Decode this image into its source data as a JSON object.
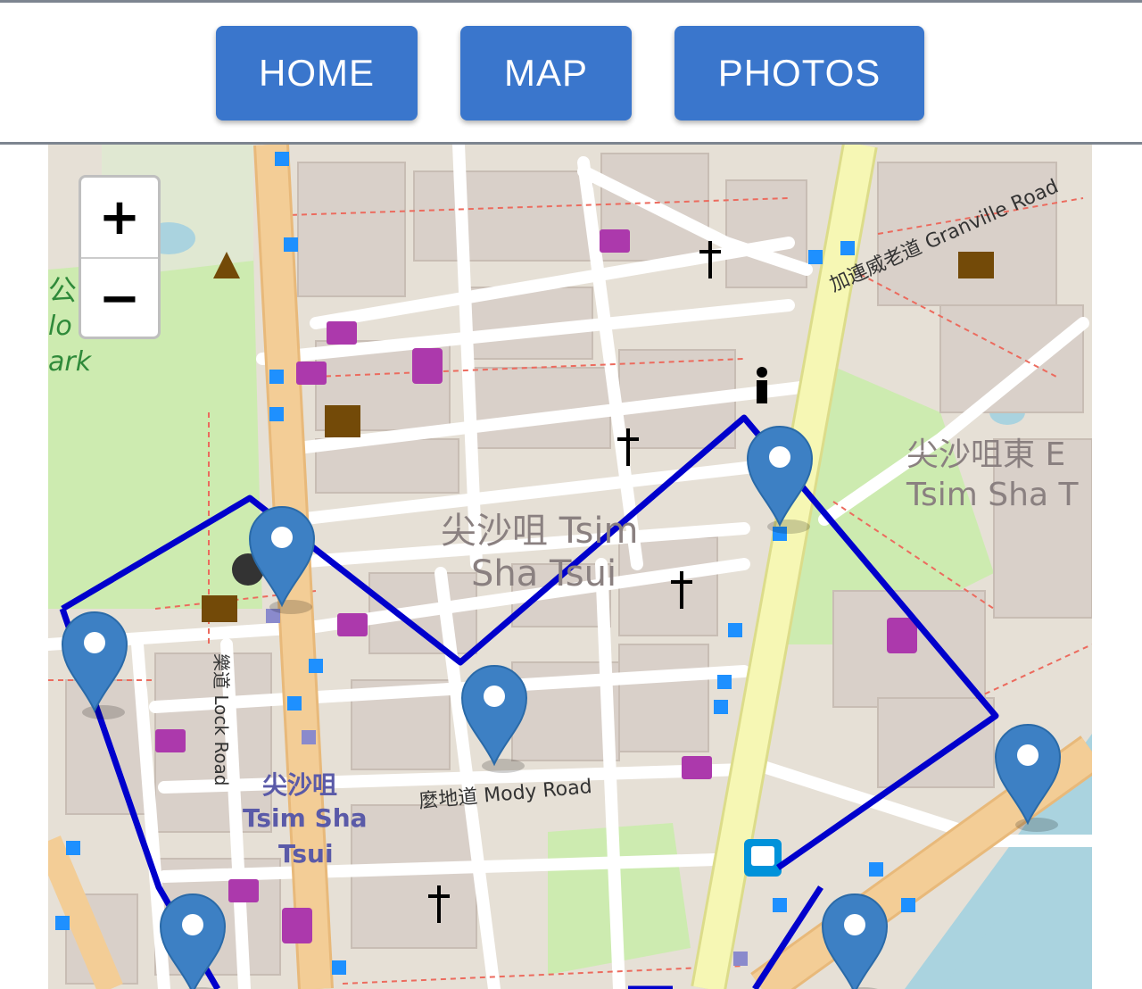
{
  "nav": {
    "buttons": [
      {
        "label": "HOME"
      },
      {
        "label": "MAP"
      },
      {
        "label": "PHOTOS"
      }
    ]
  },
  "map": {
    "zoom_in_label": "+",
    "zoom_out_label": "−",
    "labels": {
      "park_fragment_1": "公",
      "park_fragment_2": "lo",
      "park_fragment_3": "ark",
      "district_center_zh": "尖沙咀 Tsim",
      "district_center_en": "Sha Tsui",
      "district_east_zh": "尖沙咀東 E",
      "district_east_en": "Tsim Sha T",
      "district_west_zh": "尖沙咀",
      "district_west_en1": "Tsim Sha",
      "district_west_en2": "Tsui",
      "road_granville": "加連威老道 Granville Road",
      "road_mody": "麼地道 Mody Road",
      "road_lock": "樂道 Lock Road"
    },
    "colors": {
      "route": "#0000cc",
      "marker": "#3d80c4",
      "nathan_road": "#f3cd96",
      "chatham_road": "#f6f7b4",
      "water": "#aad3df",
      "park": "#cdebb0"
    },
    "marker_count": 8
  }
}
